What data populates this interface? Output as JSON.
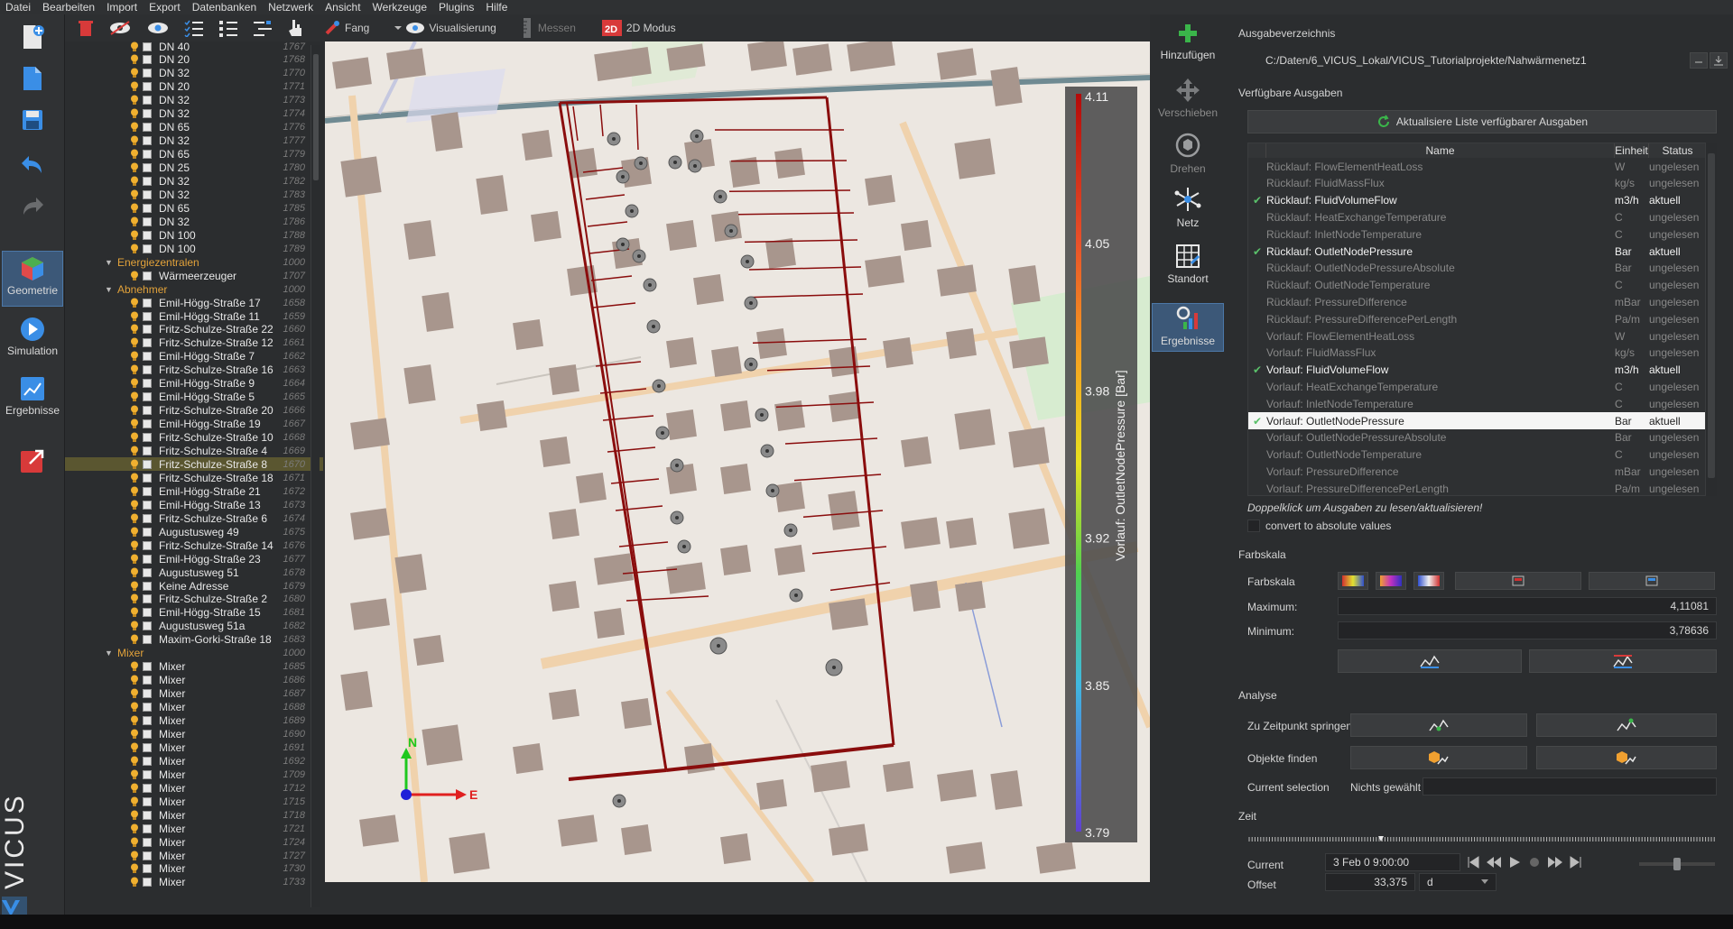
{
  "menu": [
    "Datei",
    "Bearbeiten",
    "Import",
    "Export",
    "Datenbanken",
    "Netzwerk",
    "Ansicht",
    "Werkzeuge",
    "Plugins",
    "Hilfe"
  ],
  "sidebar": {
    "modes": [
      {
        "label": "Geometrie",
        "icon": "cube-icon",
        "active": true
      },
      {
        "label": "Simulation",
        "icon": "play-icon",
        "active": false
      },
      {
        "label": "Ergebnisse",
        "icon": "chart-icon",
        "active": false
      }
    ],
    "logo_text": "VICUS"
  },
  "toolbar": {
    "fang": "Fang",
    "visualisierung": "Visualisierung",
    "messen": "Messen",
    "modus": "2D Modus"
  },
  "tree": {
    "rows": [
      {
        "type": "item",
        "name": "DN 40",
        "id": "1767"
      },
      {
        "type": "item",
        "name": "DN 20",
        "id": "1768"
      },
      {
        "type": "item",
        "name": "DN 32",
        "id": "1770"
      },
      {
        "type": "item",
        "name": "DN 20",
        "id": "1771"
      },
      {
        "type": "item",
        "name": "DN 32",
        "id": "1773"
      },
      {
        "type": "item",
        "name": "DN 32",
        "id": "1774"
      },
      {
        "type": "item",
        "name": "DN 65",
        "id": "1776"
      },
      {
        "type": "item",
        "name": "DN 32",
        "id": "1777"
      },
      {
        "type": "item",
        "name": "DN 65",
        "id": "1779"
      },
      {
        "type": "item",
        "name": "DN 25",
        "id": "1780"
      },
      {
        "type": "item",
        "name": "DN 32",
        "id": "1782"
      },
      {
        "type": "item",
        "name": "DN 32",
        "id": "1783"
      },
      {
        "type": "item",
        "name": "DN 65",
        "id": "1785"
      },
      {
        "type": "item",
        "name": "DN 32",
        "id": "1786"
      },
      {
        "type": "item",
        "name": "DN 100",
        "id": "1788"
      },
      {
        "type": "item",
        "name": "DN 100",
        "id": "1789"
      },
      {
        "type": "group",
        "name": "Energiezentralen",
        "id": "1000"
      },
      {
        "type": "item",
        "name": "Wärmeerzeuger",
        "id": "1707"
      },
      {
        "type": "group",
        "name": "Abnehmer",
        "id": "1000"
      },
      {
        "type": "item",
        "name": "Emil-Högg-Straße 17",
        "id": "1658"
      },
      {
        "type": "item",
        "name": "Emil-Högg-Straße 11",
        "id": "1659"
      },
      {
        "type": "item",
        "name": "Fritz-Schulze-Straße 22",
        "id": "1660"
      },
      {
        "type": "item",
        "name": "Fritz-Schulze-Straße 12",
        "id": "1661"
      },
      {
        "type": "item",
        "name": "Emil-Högg-Straße 7",
        "id": "1662"
      },
      {
        "type": "item",
        "name": "Fritz-Schulze-Straße 16",
        "id": "1663"
      },
      {
        "type": "item",
        "name": "Emil-Högg-Straße 9",
        "id": "1664"
      },
      {
        "type": "item",
        "name": "Emil-Högg-Straße 5",
        "id": "1665"
      },
      {
        "type": "item",
        "name": "Fritz-Schulze-Straße 20",
        "id": "1666"
      },
      {
        "type": "item",
        "name": "Emil-Högg-Straße 19",
        "id": "1667"
      },
      {
        "type": "item",
        "name": "Fritz-Schulze-Straße 10",
        "id": "1668"
      },
      {
        "type": "item",
        "name": "Fritz-Schulze-Straße 4",
        "id": "1669"
      },
      {
        "type": "item",
        "name": "Fritz-Schulze-Straße 8",
        "id": "1670",
        "selected": true
      },
      {
        "type": "item",
        "name": "Fritz-Schulze-Straße 18",
        "id": "1671"
      },
      {
        "type": "item",
        "name": "Emil-Högg-Straße 21",
        "id": "1672"
      },
      {
        "type": "item",
        "name": "Emil-Högg-Straße 13",
        "id": "1673"
      },
      {
        "type": "item",
        "name": "Fritz-Schulze-Straße 6",
        "id": "1674"
      },
      {
        "type": "item",
        "name": "Augustusweg 49",
        "id": "1675"
      },
      {
        "type": "item",
        "name": "Fritz-Schulze-Straße 14",
        "id": "1676"
      },
      {
        "type": "item",
        "name": "Emil-Högg-Straße 23",
        "id": "1677"
      },
      {
        "type": "item",
        "name": "Augustusweg 51",
        "id": "1678"
      },
      {
        "type": "item",
        "name": "Keine Adresse",
        "id": "1679"
      },
      {
        "type": "item",
        "name": "Fritz-Schulze-Straße 2",
        "id": "1680"
      },
      {
        "type": "item",
        "name": "Emil-Högg-Straße 15",
        "id": "1681"
      },
      {
        "type": "item",
        "name": "Augustusweg 51a",
        "id": "1682"
      },
      {
        "type": "item",
        "name": "Maxim-Gorki-Straße 18",
        "id": "1683"
      },
      {
        "type": "group",
        "name": "Mixer",
        "id": "1000"
      },
      {
        "type": "item",
        "name": "Mixer",
        "id": "1685"
      },
      {
        "type": "item",
        "name": "Mixer",
        "id": "1686"
      },
      {
        "type": "item",
        "name": "Mixer",
        "id": "1687"
      },
      {
        "type": "item",
        "name": "Mixer",
        "id": "1688"
      },
      {
        "type": "item",
        "name": "Mixer",
        "id": "1689"
      },
      {
        "type": "item",
        "name": "Mixer",
        "id": "1690"
      },
      {
        "type": "item",
        "name": "Mixer",
        "id": "1691"
      },
      {
        "type": "item",
        "name": "Mixer",
        "id": "1692"
      },
      {
        "type": "item",
        "name": "Mixer",
        "id": "1709"
      },
      {
        "type": "item",
        "name": "Mixer",
        "id": "1712"
      },
      {
        "type": "item",
        "name": "Mixer",
        "id": "1715"
      },
      {
        "type": "item",
        "name": "Mixer",
        "id": "1718"
      },
      {
        "type": "item",
        "name": "Mixer",
        "id": "1721"
      },
      {
        "type": "item",
        "name": "Mixer",
        "id": "1724"
      },
      {
        "type": "item",
        "name": "Mixer",
        "id": "1727"
      },
      {
        "type": "item",
        "name": "Mixer",
        "id": "1730"
      },
      {
        "type": "item",
        "name": "Mixer",
        "id": "1733"
      }
    ]
  },
  "map": {
    "legend_title": "Vorlauf: OutletNodePressure [Bar]",
    "legend_ticks": [
      "4.11",
      "4.05",
      "3.98",
      "3.92",
      "3.85",
      "3.79"
    ],
    "axis_n": "N",
    "axis_e": "E"
  },
  "vtools": [
    {
      "label": "Hinzufügen",
      "icon": "plus-icon",
      "enabled": true
    },
    {
      "label": "Verschieben",
      "icon": "move-icon",
      "enabled": false
    },
    {
      "label": "Drehen",
      "icon": "rotate-icon",
      "enabled": false
    },
    {
      "label": "Netz",
      "icon": "network-icon",
      "enabled": true
    },
    {
      "label": "Standort",
      "icon": "grid-icon",
      "enabled": true
    },
    {
      "label": "Ergebnisse",
      "icon": "results-icon",
      "enabled": true,
      "active": true
    }
  ],
  "panel": {
    "ausgabeverzeichnis_label": "Ausgabeverzeichnis",
    "path": "C:/Daten/6_VICUS_Lokal/VICUS_Tutorialprojekte/Nahwärmenetz1",
    "verfuegbare_label": "Verfügbare Ausgaben",
    "refresh_button": "Aktualisiere Liste verfügbarer Ausgaben",
    "table_headers": {
      "name": "Name",
      "unit": "Einheit",
      "status": "Status"
    },
    "outputs": [
      {
        "name": "Rücklauf: FlowElementHeatLoss",
        "unit": "W",
        "status": "ungelesen",
        "checked": false
      },
      {
        "name": "Rücklauf: FluidMassFlux",
        "unit": "kg/s",
        "status": "ungelesen",
        "checked": false
      },
      {
        "name": "Rücklauf: FluidVolumeFlow",
        "unit": "m3/h",
        "status": "aktuell",
        "checked": true
      },
      {
        "name": "Rücklauf: HeatExchangeTemperature",
        "unit": "C",
        "status": "ungelesen",
        "checked": false
      },
      {
        "name": "Rücklauf: InletNodeTemperature",
        "unit": "C",
        "status": "ungelesen",
        "checked": false
      },
      {
        "name": "Rücklauf: OutletNodePressure",
        "unit": "Bar",
        "status": "aktuell",
        "checked": true
      },
      {
        "name": "Rücklauf: OutletNodePressureAbsolute",
        "unit": "Bar",
        "status": "ungelesen",
        "checked": false
      },
      {
        "name": "Rücklauf: OutletNodeTemperature",
        "unit": "C",
        "status": "ungelesen",
        "checked": false
      },
      {
        "name": "Rücklauf: PressureDifference",
        "unit": "mBar",
        "status": "ungelesen",
        "checked": false
      },
      {
        "name": "Rücklauf: PressureDifferencePerLength",
        "unit": "Pa/m",
        "status": "ungelesen",
        "checked": false
      },
      {
        "name": "Vorlauf: FlowElementHeatLoss",
        "unit": "W",
        "status": "ungelesen",
        "checked": false
      },
      {
        "name": "Vorlauf: FluidMassFlux",
        "unit": "kg/s",
        "status": "ungelesen",
        "checked": false
      },
      {
        "name": "Vorlauf: FluidVolumeFlow",
        "unit": "m3/h",
        "status": "aktuell",
        "checked": true
      },
      {
        "name": "Vorlauf: HeatExchangeTemperature",
        "unit": "C",
        "status": "ungelesen",
        "checked": false
      },
      {
        "name": "Vorlauf: InletNodeTemperature",
        "unit": "C",
        "status": "ungelesen",
        "checked": false
      },
      {
        "name": "Vorlauf: OutletNodePressure",
        "unit": "Bar",
        "status": "aktuell",
        "checked": true,
        "selected": true
      },
      {
        "name": "Vorlauf: OutletNodePressureAbsolute",
        "unit": "Bar",
        "status": "ungelesen",
        "checked": false
      },
      {
        "name": "Vorlauf: OutletNodeTemperature",
        "unit": "C",
        "status": "ungelesen",
        "checked": false
      },
      {
        "name": "Vorlauf: PressureDifference",
        "unit": "mBar",
        "status": "ungelesen",
        "checked": false
      },
      {
        "name": "Vorlauf: PressureDifferencePerLength",
        "unit": "Pa/m",
        "status": "ungelesen",
        "checked": false
      }
    ],
    "hint": "Doppelklick um Ausgaben zu lesen/aktualisieren!",
    "absolute_checkbox": "convert to absolute values",
    "farbskala_section": "Farbskala",
    "farbskala_label": "Farbskala",
    "maximum_label": "Maximum:",
    "maximum_value": "4,11081",
    "minimum_label": "Minimum:",
    "minimum_value": "3,78636",
    "analyse_section": "Analyse",
    "zeitpunkt_label": "Zu Zeitpunkt springen",
    "objekte_label": "Objekte finden",
    "selection_label": "Current selection",
    "selection_value": "Nichts gewählt",
    "zeit_section": "Zeit",
    "current_label": "Current",
    "current_value": "3 Feb 0   9:00:00",
    "offset_label": "Offset",
    "offset_value": "33,375",
    "offset_unit": "d"
  }
}
